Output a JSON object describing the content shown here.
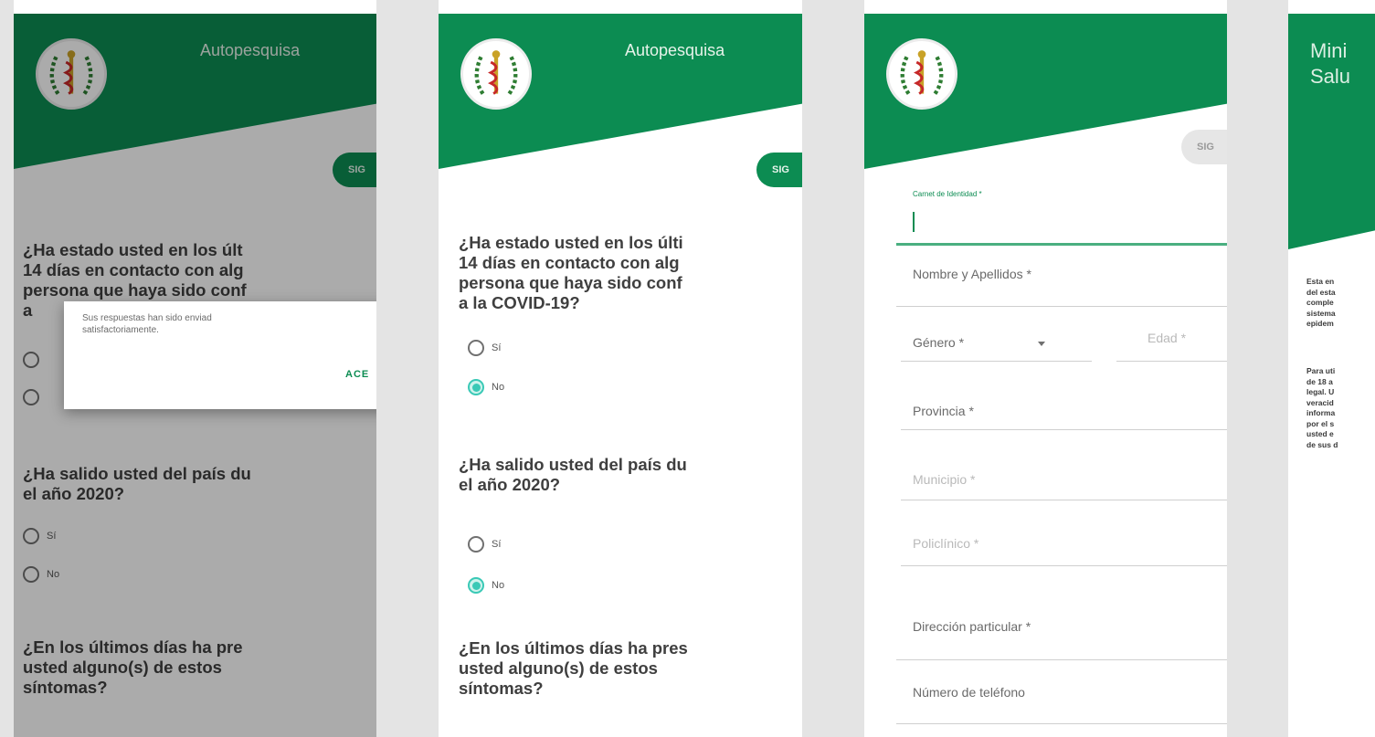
{
  "app": {
    "title": "Autopesquisa",
    "next_label": "SIG"
  },
  "panel1": {
    "q1": [
      "¿Ha estado usted en los últ",
      "14 días en contacto con alg",
      "persona que haya sido conf",
      "a"
    ],
    "dialog": {
      "message": "Sus respuestas han sido enviad\nsatisfactoriamente.",
      "button": "ACE"
    },
    "q2": [
      "¿Ha salido usted del país du",
      "el año 2020?"
    ],
    "q2_options": [
      "Sí",
      "No"
    ],
    "q3": [
      "¿En los últimos días ha pre",
      "usted alguno(s) de estos",
      "síntomas?"
    ]
  },
  "panel2": {
    "q1": [
      "¿Ha estado usted en los últi",
      "14 días en contacto con alg",
      "persona que haya sido conf",
      "a la COVID-19?"
    ],
    "q1_options": [
      "Sí",
      "No"
    ],
    "q1_selected": "No",
    "q2": [
      "¿Ha salido usted del país du",
      "el año 2020?"
    ],
    "q2_options": [
      "Sí",
      "No"
    ],
    "q2_selected": "No",
    "q3": [
      "¿En los últimos días ha pres",
      "usted alguno(s) de estos",
      "síntomas?"
    ]
  },
  "panel3": {
    "fields": {
      "carnet": "Carnet de Identidad *",
      "nombre": "Nombre y Apellidos *",
      "genero": "Género *",
      "edad": "Edad *",
      "provincia": "Provincia *",
      "municipio": "Municipio *",
      "policlinico": "Policlínico *",
      "direccion": "Dirección particular *",
      "telefono": "Número de teléfono"
    },
    "next_label": "SIG"
  },
  "panel4": {
    "title": [
      "Mini",
      "Salu"
    ],
    "para1": [
      "Esta en",
      "del esta",
      "comple",
      "sistema",
      "epidem"
    ],
    "para2": [
      "Para uti",
      "de 18 a",
      "legal. U",
      "veracid",
      "informa",
      "por el s",
      "usted e",
      "de sus d"
    ]
  },
  "colors": {
    "brand_green": "#0c8c52",
    "radio_selected": "#3ac9b6"
  }
}
